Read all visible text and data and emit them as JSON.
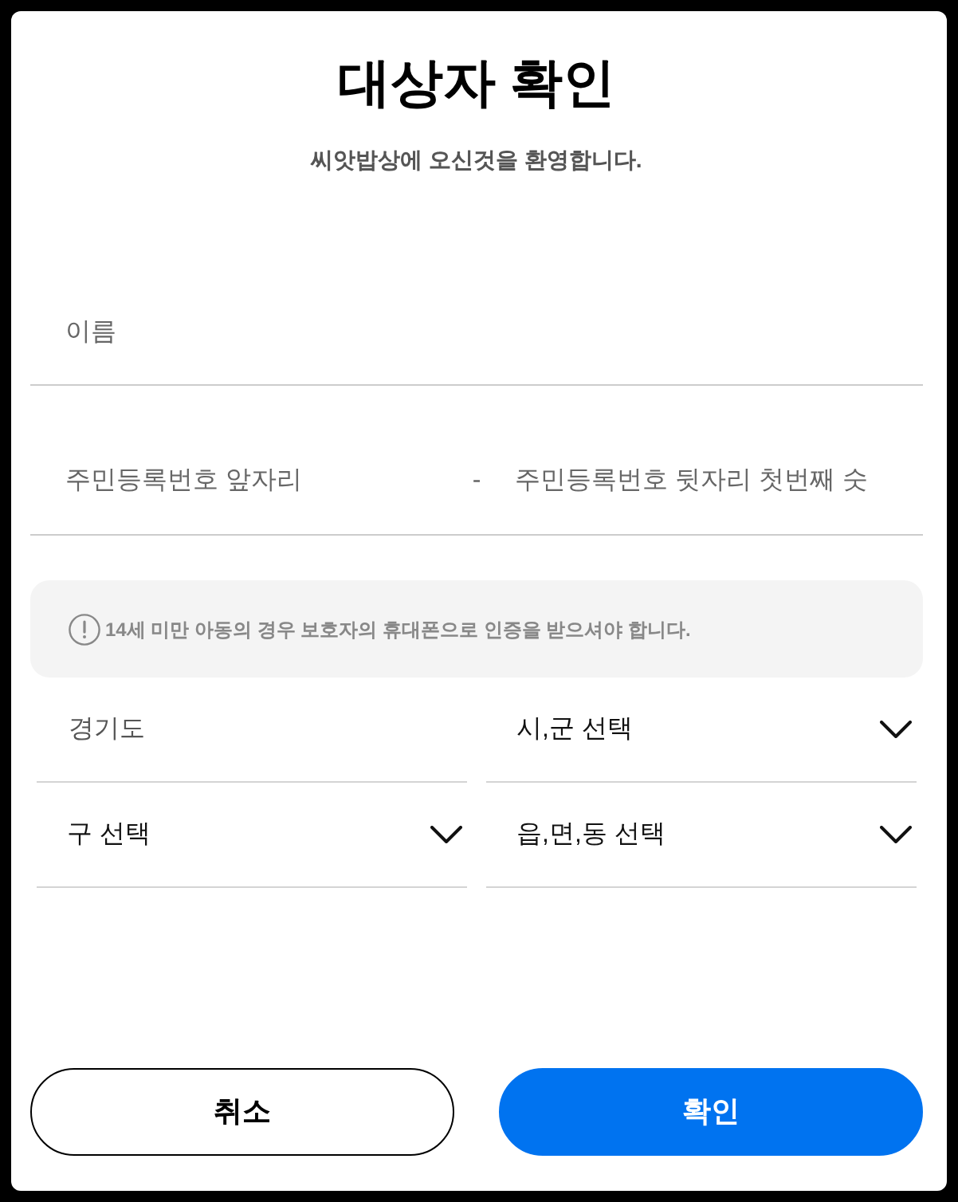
{
  "dialog": {
    "title": "대상자 확인",
    "subtitle": "씨앗밥상에 오신것을 환영합니다."
  },
  "name_field": {
    "placeholder": "이름"
  },
  "id_number": {
    "front_placeholder": "주민등록번호 앞자리",
    "separator": "-",
    "back_placeholder": "주민등록번호 뒷자리 첫번째 숫"
  },
  "notice": {
    "text": "14세 미만 아동의 경우 보호자의 휴대폰으로 인증을 받으셔야 합니다."
  },
  "address": [
    {
      "kind": "fixed",
      "value": "경기도"
    },
    {
      "kind": "select",
      "value": "시,군 선택"
    },
    {
      "kind": "select",
      "value": "구 선택"
    },
    {
      "kind": "select",
      "value": "읍,면,동 선택"
    }
  ],
  "buttons": [
    {
      "kind": "secondary",
      "label": "취소"
    },
    {
      "kind": "primary",
      "label": "확인"
    }
  ]
}
